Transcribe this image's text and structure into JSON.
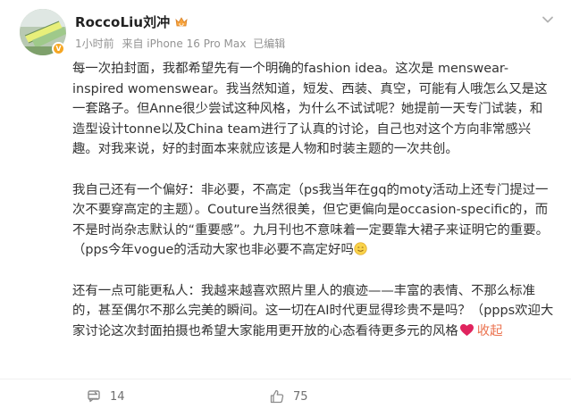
{
  "post": {
    "user_name": "RoccoLiu刘冲",
    "time": "1小时前",
    "source": "来自 iPhone 16 Pro Max",
    "edited": "已编辑",
    "paragraphs": [
      "每一次拍封面，我都希望先有一个明确的fashion idea。这次是 menswear-inspired womenswear。我当然知道，短发、西装、真空，可能有人哦怎么又是这一套路子。但Anne很少尝试这种风格，为什么不试试呢？她提前一天专门试装，和造型设计tonne以及China team进行了认真的讨论，自己也对这个方向非常感兴趣。对我来说，好的封面本来就应该是人物和时装主题的一次共创。",
      "我自己还有一个偏好：非必要，不高定（ps我当年在gq的moty活动上还专门提过一次不要穿高定的主题）。Couture当然很美，但它更偏向是occasion-specific的，而不是时尚杂志默认的“重要感”。九月刊也不意味着一定要靠大裙子来证明它的重要。（pps今年vogue的活动大家也非必要不高定好吗",
      "还有一点可能更私人：我越来越喜欢照片里人的痕迹——丰富的表情、不那么标准的，甚至偶尔不那么完美的瞬间。这一切在AI时代更显得珍贵不是吗？（ppps欢迎大家讨论这次封面拍摄也希望大家能用更开放的心态看待更多元的风格"
    ],
    "collapse_label": "收起"
  },
  "footer": {
    "repost_count": "",
    "comment_count": "14",
    "like_count": "75"
  },
  "icons": {
    "crown": "crown-badge-icon",
    "verified": "verified-v-icon",
    "chevron": "chevron-down-icon",
    "smile": "smile-emoji-icon",
    "heart": "red-heart-icon",
    "repost": "repost-icon",
    "comment": "comment-icon",
    "like": "like-icon"
  },
  "colors": {
    "link": "#eb7350",
    "heart": "#e0245e",
    "crown": "#f7a33b",
    "meta": "#939393"
  }
}
